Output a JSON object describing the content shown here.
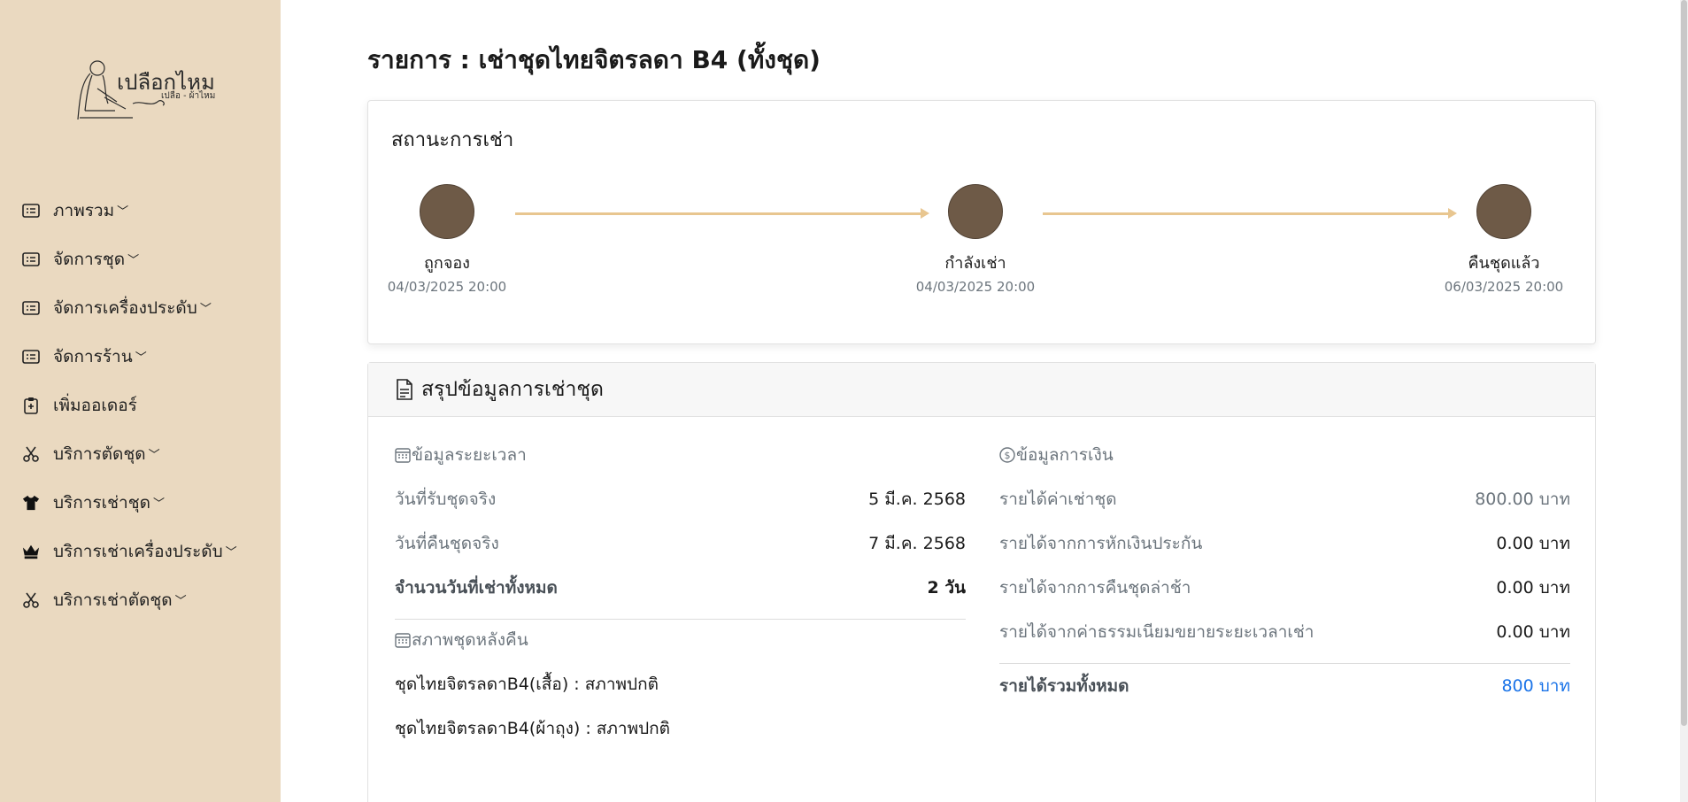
{
  "brand": {
    "logo_text": "เปลือกไหม",
    "logo_sub": "เปลือ - ผ้าไหม"
  },
  "sidebar": {
    "items": [
      {
        "label": "ภาพรวม",
        "icon": "list-card-icon",
        "has_caret": true
      },
      {
        "label": "จัดการชุด",
        "icon": "list-card-icon",
        "has_caret": true
      },
      {
        "label": "จัดการเครื่องประดับ",
        "icon": "list-card-icon",
        "has_caret": true
      },
      {
        "label": "จัดการร้าน",
        "icon": "list-card-icon",
        "has_caret": true
      },
      {
        "label": "เพิ่มออเดอร์",
        "icon": "clipboard-plus-icon",
        "has_caret": false
      },
      {
        "label": "บริการตัดชุด",
        "icon": "scissors-icon",
        "has_caret": true
      },
      {
        "label": "บริการเช่าชุด",
        "icon": "tshirt-icon",
        "has_caret": true
      },
      {
        "label": "บริการเช่าเครื่องประดับ",
        "icon": "crown-icon",
        "has_caret": true
      },
      {
        "label": "บริการเช่าตัดชุด",
        "icon": "scissors-icon",
        "has_caret": true
      }
    ],
    "caret": "﹀"
  },
  "page": {
    "title": "รายการ : เช่าชุดไทยจิตรลดา B4 (ทั้งชุด)"
  },
  "status": {
    "title": "สถานะการเช่า",
    "steps": [
      {
        "label": "ถูกจอง",
        "date": "04/03/2025 20:00"
      },
      {
        "label": "กำลังเช่า",
        "date": "04/03/2025 20:00"
      },
      {
        "label": "คืนชุดแล้ว",
        "date": "06/03/2025 20:00"
      }
    ]
  },
  "summary": {
    "title": "สรุปข้อมูลการเช่าชุด",
    "time": {
      "heading": "ข้อมูลระยะเวลา",
      "rows": [
        {
          "label": "วันที่รับชุดจริง",
          "value": "5 มี.ค. 2568"
        },
        {
          "label": "วันที่คืนชุดจริง",
          "value": "7 มี.ค. 2568"
        },
        {
          "label": "จำนวนวันที่เช่าทั้งหมด",
          "value": "2 วัน"
        }
      ]
    },
    "condition": {
      "heading": "สภาพชุดหลังคืน",
      "items": [
        "ชุดไทยจิตรลดาB4(เสื้อ) : สภาพปกติ",
        "ชุดไทยจิตรลดาB4(ผ้าถุง) : สภาพปกติ"
      ]
    },
    "money": {
      "heading": "ข้อมูลการเงิน",
      "rows": [
        {
          "label": "รายได้ค่าเช่าชุด",
          "value": "800.00 บาท"
        },
        {
          "label": "รายได้จากการหักเงินประกัน",
          "value": "0.00 บาท"
        },
        {
          "label": "รายได้จากการคืนชุดล่าช้า",
          "value": "0.00 บาท"
        },
        {
          "label": "รายได้จากค่าธรรมเนียมขยายระยะเวลาเช่า",
          "value": "0.00 บาท"
        }
      ],
      "total_label": "รายได้รวมทั้งหมด",
      "total_value": "800 บาท"
    }
  },
  "colors": {
    "sidebar_bg": "#ead9c0",
    "status_dot": "#6e5a47",
    "arrow": "#e8c690",
    "total_accent": "#1a73e8"
  }
}
